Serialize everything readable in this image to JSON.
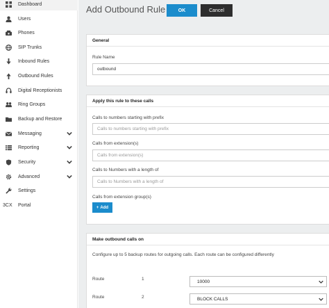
{
  "sidebar": {
    "items": [
      {
        "label": "Dashboard",
        "icon": "dashboard-icon",
        "expandable": false
      },
      {
        "label": "Users",
        "icon": "user-icon",
        "expandable": false
      },
      {
        "label": "Phones",
        "icon": "phone-icon",
        "expandable": false
      },
      {
        "label": "SIP Trunks",
        "icon": "globe-icon",
        "expandable": false
      },
      {
        "label": "Inbound Rules",
        "icon": "arrow-down-icon",
        "expandable": false
      },
      {
        "label": "Outbound Rules",
        "icon": "arrow-up-icon",
        "expandable": false
      },
      {
        "label": "Digital Receptionists",
        "icon": "headset-icon",
        "expandable": false
      },
      {
        "label": "Ring Groups",
        "icon": "group-icon",
        "expandable": false
      },
      {
        "label": "Backup and Restore",
        "icon": "folder-icon",
        "expandable": false
      },
      {
        "label": "Messaging",
        "icon": "envelope-icon",
        "expandable": true
      },
      {
        "label": "Reporting",
        "icon": "list-icon",
        "expandable": true
      },
      {
        "label": "Security",
        "icon": "shield-icon",
        "expandable": true
      },
      {
        "label": "Advanced",
        "icon": "gear-icon",
        "expandable": true
      },
      {
        "label": "Settings",
        "icon": "wrench-icon",
        "expandable": false
      },
      {
        "label": "Portal",
        "icon": "3cx-logo",
        "prefix": "3CX",
        "expandable": false
      }
    ]
  },
  "header": {
    "title": "Add Outbound Rule",
    "ok_label": "OK",
    "cancel_label": "Cancel"
  },
  "general": {
    "header": "General",
    "rule_name_label": "Rule Name",
    "rule_name_value": "outbound"
  },
  "apply_rule": {
    "header": "Apply this rule to these calls",
    "prefix_label": "Calls to numbers starting with prefix",
    "prefix_placeholder": "Calls to numbers starting with prefix",
    "extension_label": "Calls from extension(s)",
    "extension_placeholder": "Calls from extension(s)",
    "length_label": "Calls to Numbers with a length of",
    "length_placeholder": "Calls to Numbers with a length of",
    "group_label": "Calls from extension group(s)",
    "add_label": "Add"
  },
  "outbound": {
    "header": "Make outbound calls on",
    "description": "Configure up to 5 backup routes for outgoing calls. Each route can be configured differently",
    "routes": [
      {
        "label": "Route",
        "number": "1",
        "selected": "10000"
      },
      {
        "label": "Route",
        "number": "2",
        "selected": "BLOCK CALLS"
      }
    ]
  },
  "colors": {
    "accent": "#1b8ccc",
    "cancel": "#2e2e2e",
    "background": "#eceeef"
  }
}
